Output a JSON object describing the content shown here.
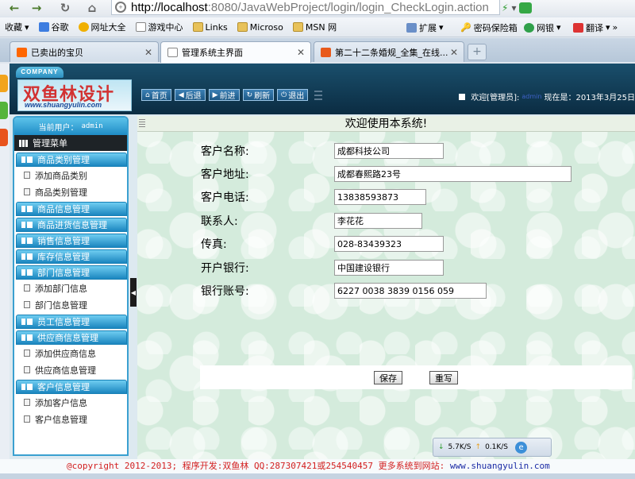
{
  "browser": {
    "url_host": "http://localhost",
    "url_rest": ":8080/JavaWebProject/login/login_CheckLogin.action",
    "favorites": [
      "收藏",
      "谷歌",
      "网址大全",
      "游戏中心",
      "Links",
      "Microso",
      "MSN 网"
    ],
    "favorites_right": [
      "扩展",
      "密码保险箱",
      "网银",
      "翻译"
    ],
    "tabs": [
      {
        "title": "已卖出的宝贝",
        "active": false
      },
      {
        "title": "管理系统主界面",
        "active": true
      },
      {
        "title": "第二十二条婚规_全集_在线...",
        "active": false
      }
    ],
    "new_tab": "+"
  },
  "header": {
    "company": "COMPANY",
    "logo_text": "双鱼林设计",
    "logo_url": "www.shuangyulin.com",
    "nav": [
      "首页",
      "后退",
      "前进",
      "刷新",
      "退出"
    ],
    "welcome_prefix": "欢迎[管理员]:",
    "welcome_user": "admin",
    "date_text": "现在是：2013年3月25日"
  },
  "sidebar": {
    "current_user_label": "当前用户：",
    "current_user": "admin",
    "menu_title": "管理菜单",
    "groups": [
      {
        "label": "商品类别管理",
        "items": [
          "添加商品类别",
          "商品类别管理"
        ]
      },
      {
        "label": "商品信息管理",
        "items": []
      },
      {
        "label": "商品进货信息管理",
        "items": []
      },
      {
        "label": "销售信息管理",
        "items": []
      },
      {
        "label": "库存信息管理",
        "items": []
      },
      {
        "label": "部门信息管理",
        "items": [
          "添加部门信息",
          "部门信息管理"
        ]
      },
      {
        "label": "员工信息管理",
        "items": []
      },
      {
        "label": "供应商信息管理",
        "items": [
          "添加供应商信息",
          "供应商信息管理"
        ]
      },
      {
        "label": "客户信息管理",
        "items": [
          "添加客户信息",
          "客户信息管理"
        ]
      }
    ]
  },
  "main": {
    "title": "欢迎使用本系统!",
    "fields": [
      {
        "label": "客户名称:",
        "value": "成都科技公司"
      },
      {
        "label": "客户地址:",
        "value": "成都春熙路23号"
      },
      {
        "label": "客户电话:",
        "value": "13838593873"
      },
      {
        "label": "联系人:",
        "value": "李花花"
      },
      {
        "label": "传真:",
        "value": "028-83439323"
      },
      {
        "label": "开户银行:",
        "value": "中国建设银行"
      },
      {
        "label": "银行账号:",
        "value": "6227 0038 3839 0156 059"
      }
    ],
    "save_label": "保存",
    "reset_label": "重写"
  },
  "speed": {
    "down": "5.7K/S",
    "up": "0.1K/S"
  },
  "footer": {
    "text": "@copyright 2012-2013; 程序开发:双鱼林  QQ:287307421或254540457  更多系统到网站: ",
    "site": "www.shuangyulin.com"
  },
  "colors": {
    "accent": "#1f8cc6",
    "header_bg": "#0b2c42",
    "footer_text": "#d21e1e"
  }
}
